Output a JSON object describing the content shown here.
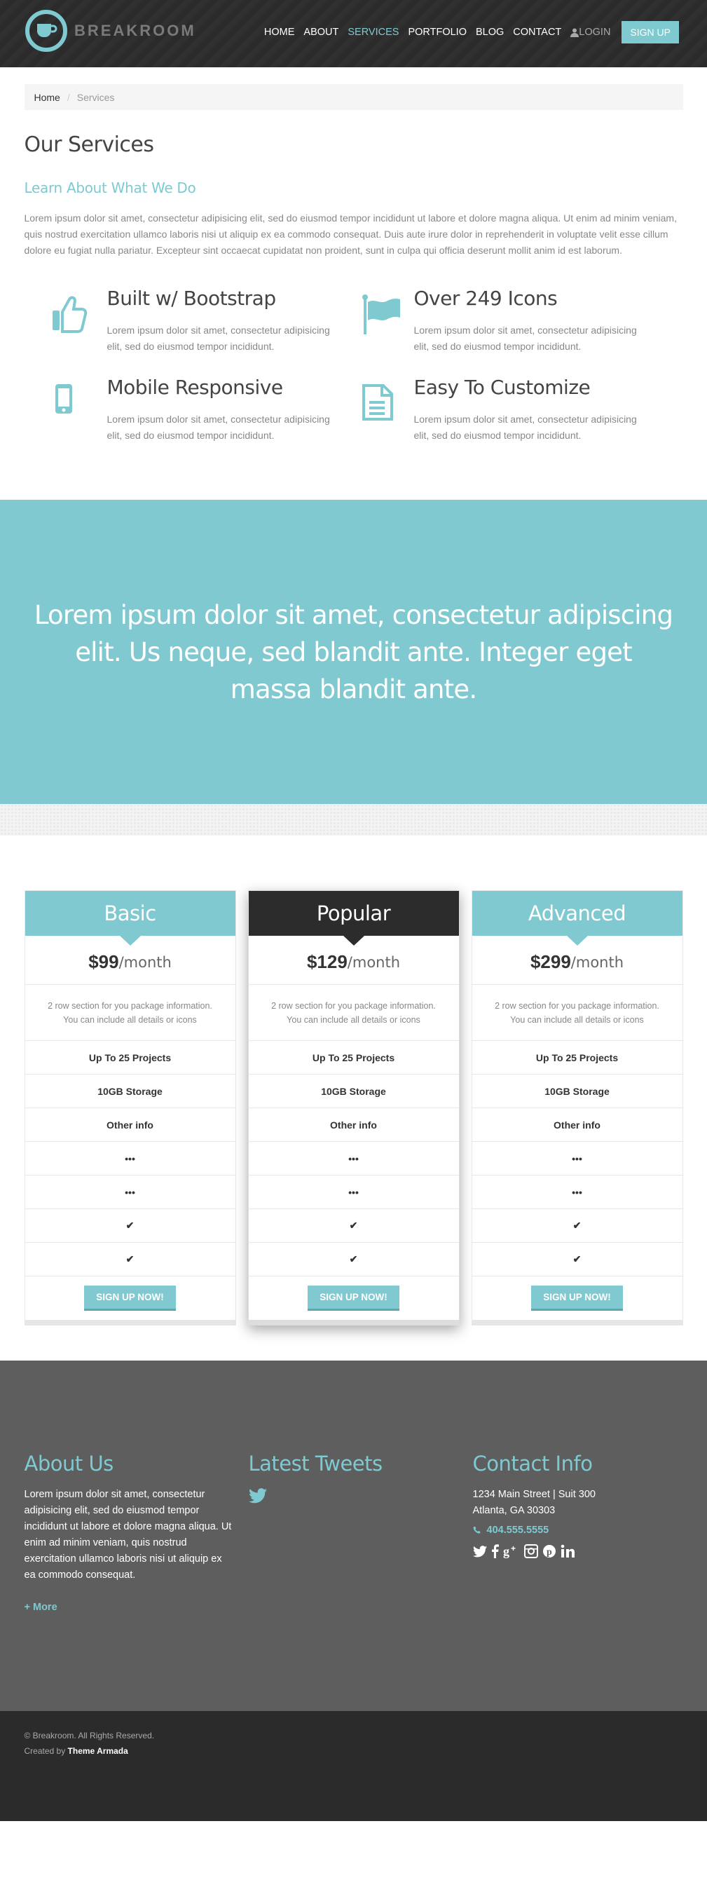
{
  "brand": {
    "name": "BREAKROOM"
  },
  "nav": {
    "items": [
      "HOME",
      "ABOUT",
      "SERVICES",
      "PORTFOLIO",
      "BLOG",
      "CONTACT"
    ],
    "login": "LOGIN",
    "signup": "SIGN UP"
  },
  "breadcrumb": {
    "home": "Home",
    "current": "Services"
  },
  "page": {
    "title": "Our Services",
    "subtitle": "Learn About What We Do",
    "intro": "Lorem ipsum dolor sit amet, consectetur adipisicing elit, sed do eiusmod tempor incididunt ut labore et dolore magna aliqua. Ut enim ad minim veniam, quis nostrud exercitation ullamco laboris nisi ut aliquip ex ea commodo consequat. Duis aute irure dolor in reprehenderit in voluptate velit esse cillum dolore eu fugiat nulla pariatur. Excepteur sint occaecat cupidatat non proident, sunt in culpa qui officia deserunt mollit anim id est laborum."
  },
  "features": [
    {
      "icon": "thumbs-up-icon",
      "title": "Built w/ Bootstrap",
      "text": "Lorem ipsum dolor sit amet, consectetur adipisicing elit, sed do eiusmod tempor incididunt."
    },
    {
      "icon": "flag-icon",
      "title": "Over 249 Icons",
      "text": "Lorem ipsum dolor sit amet, consectetur adipisicing elit, sed do eiusmod tempor incididunt."
    },
    {
      "icon": "mobile-icon",
      "title": "Mobile Responsive",
      "text": "Lorem ipsum dolor sit amet, consectetur adipisicing elit, sed do eiusmod tempor incididunt."
    },
    {
      "icon": "document-icon",
      "title": "Easy To Customize",
      "text": "Lorem ipsum dolor sit amet, consectetur adipisicing elit, sed do eiusmod tempor incididunt."
    }
  ],
  "banner": {
    "text": "Lorem ipsum dolor sit amet, consectetur adipiscing elit. Us neque, sed blandit ante. Integer eget massa blandit ante."
  },
  "plans": [
    {
      "name": "Basic",
      "price": "$99",
      "period": "/month",
      "desc1": "2 row section for you package information.",
      "desc2": "You can include all details or icons",
      "features": [
        "Up To 25 Projects",
        "10GB Storage",
        "Other info",
        "•••",
        "•••",
        "✔",
        "✔"
      ],
      "button": "SIGN UP NOW!"
    },
    {
      "name": "Popular",
      "price": "$129",
      "period": "/month",
      "desc1": "2 row section for you package information.",
      "desc2": "You can include all details or icons",
      "features": [
        "Up To 25 Projects",
        "10GB Storage",
        "Other info",
        "•••",
        "•••",
        "✔",
        "✔"
      ],
      "button": "SIGN UP NOW!"
    },
    {
      "name": "Advanced",
      "price": "$299",
      "period": "/month",
      "desc1": "2 row section for you package information.",
      "desc2": "You can include all details or icons",
      "features": [
        "Up To 25 Projects",
        "10GB Storage",
        "Other info",
        "•••",
        "•••",
        "✔",
        "✔"
      ],
      "button": "SIGN UP NOW!"
    }
  ],
  "footer": {
    "about_title": "About Us",
    "about_text": "Lorem ipsum dolor sit amet, consectetur adipisicing elit, sed do eiusmod tempor incididunt ut labore et dolore magna aliqua. Ut enim ad minim veniam, quis nostrud exercitation ullamco laboris nisi ut aliquip ex ea commodo consequat.",
    "more": "+ More",
    "tweets_title": "Latest Tweets",
    "contact_title": "Contact Info",
    "address1": "1234 Main Street | Suit 300",
    "address2": "Atlanta, GA 30303",
    "phone": "404.555.5555",
    "socials": [
      "twitter-icon",
      "facebook-icon",
      "google-plus-icon",
      "instagram-icon",
      "pinterest-icon",
      "linkedin-icon"
    ],
    "copyright": "© Breakroom. All Rights Reserved.",
    "created_prefix": "Created by",
    "created_by": "Theme Armada"
  },
  "colors": {
    "accent": "#80c9d0",
    "dark": "#2b2b2b",
    "footer": "#5e5e5e"
  }
}
